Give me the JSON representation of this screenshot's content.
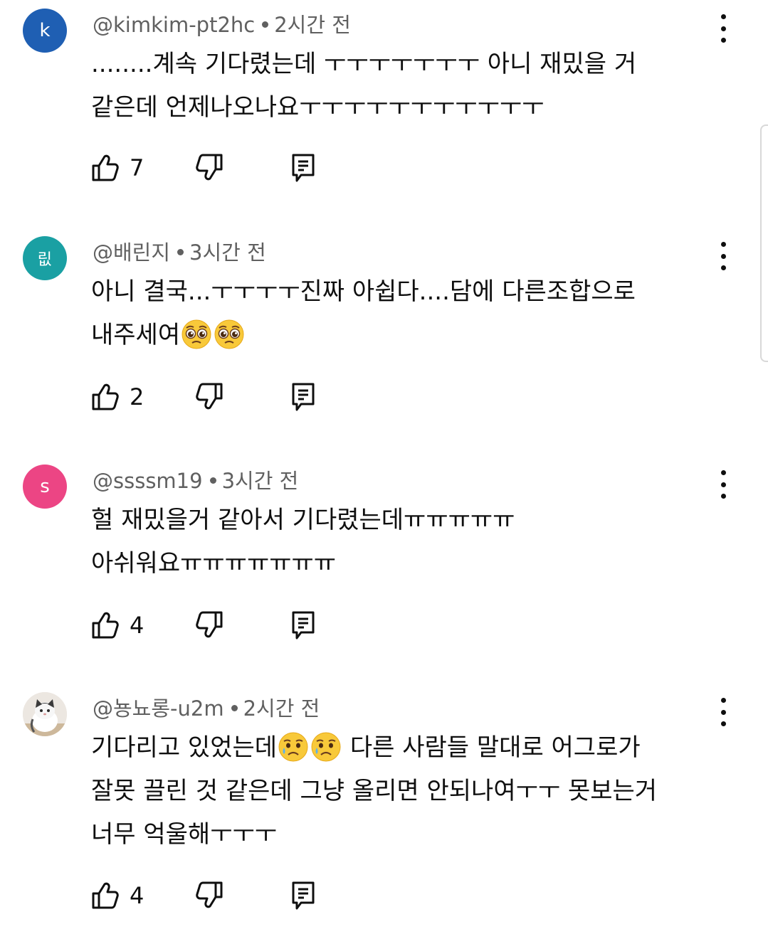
{
  "colors": {
    "avatar_k": "#1f5fb3",
    "avatar_ril": "#1aa0a3",
    "avatar_s": "#ec4584",
    "text_primary": "#0f0f0f",
    "text_secondary": "#606060"
  },
  "comments": [
    {
      "avatar_letter": "k",
      "author": "@kimkim-pt2hc",
      "time": "2시간 전",
      "line1": "........계속 기다렸는데 ㅜㅜㅜㅜㅜㅜㅜ 아니 재밌을 거",
      "line2": "같은데 언제나오나요ㅜㅜㅜㅜㅜㅜㅜㅜㅜㅜㅜ",
      "likes": "7"
    },
    {
      "avatar_letter": "릾",
      "author": "@배린지",
      "time": "3시간 전",
      "line1": "아니 결국...ㅜㅜㅜㅜ진짜 아쉽다....담에 다른조합으로",
      "line2_text": "내주세여",
      "line2_emojis": [
        "pleading-face-emoji",
        "pleading-face-emoji"
      ],
      "likes": "2"
    },
    {
      "avatar_letter": "s",
      "author": "@ssssm19",
      "time": "3시간 전",
      "line1": "헐 재밌을거 같아서 기다렸는데ㅠㅠㅠㅠㅠ",
      "line2": "아쉬워요ㅠㅠㅠㅠㅠㅠㅠ",
      "likes": "4"
    },
    {
      "avatar_image": "cat-photo",
      "author": "@뇽뇨롱-u2m",
      "time": "2시간 전",
      "line1_text": "기다리고 있었는데",
      "line1_emojis": [
        "crying-face-emoji",
        "crying-face-emoji"
      ],
      "line1_rest": " 다른 사람들 말대로 어그로가",
      "line2": "잘못 끌린 것 같은데 그냥 올리면 안되나여ㅜㅜ 못보는거",
      "line3": "너무 억울해ㅜㅜㅜ",
      "likes": "4"
    }
  ],
  "icons": {
    "like": "thumb-up-icon",
    "dislike": "thumb-down-icon",
    "reply": "reply-icon",
    "more": "more-vertical-icon"
  }
}
